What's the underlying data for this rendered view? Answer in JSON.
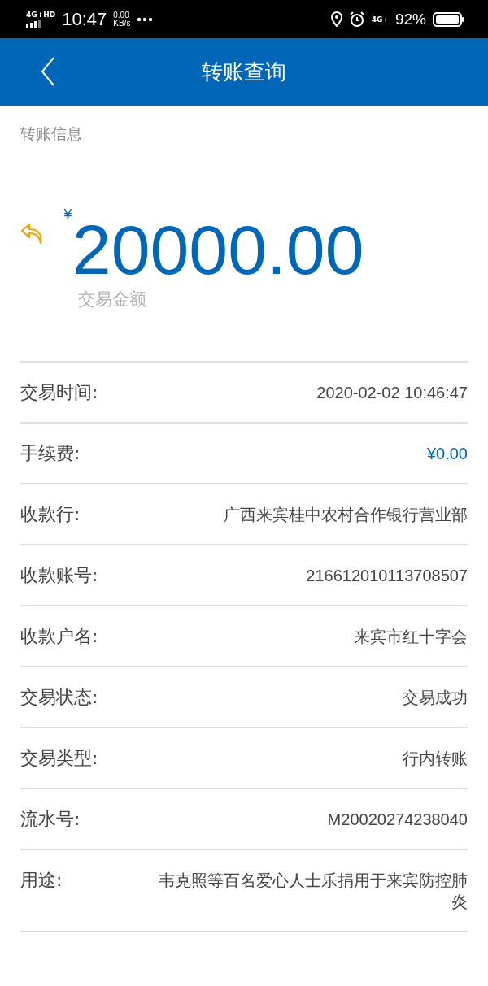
{
  "status_bar": {
    "network": "4G+HD",
    "time": "10:47",
    "speed": "0.00",
    "speed_unit": "KB/s",
    "mobile": "4G+",
    "battery": "92%"
  },
  "header": {
    "title": "转账查询"
  },
  "section_label": "转账信息",
  "amount": {
    "currency": "¥",
    "value": "20000.00",
    "caption": "交易金额"
  },
  "details": [
    {
      "label": "交易时间:",
      "value": "2020-02-02 10:46:47",
      "emphasis": false
    },
    {
      "label": "手续费:",
      "value": "¥0.00",
      "emphasis": true
    },
    {
      "label": "收款行:",
      "value": "广西来宾桂中农村合作银行营业部",
      "emphasis": false
    },
    {
      "label": "收款账号:",
      "value": "216612010113708507",
      "emphasis": false
    },
    {
      "label": "收款户名:",
      "value": "来宾市红十字会",
      "emphasis": false
    },
    {
      "label": "交易状态:",
      "value": "交易成功",
      "emphasis": false
    },
    {
      "label": "交易类型:",
      "value": "行内转账",
      "emphasis": false
    },
    {
      "label": "流水号:",
      "value": "M20020274238040",
      "emphasis": false
    },
    {
      "label": "用途:",
      "value": "韦克照等百名爱心人士乐捐用于来宾防控肺炎",
      "emphasis": false
    }
  ]
}
